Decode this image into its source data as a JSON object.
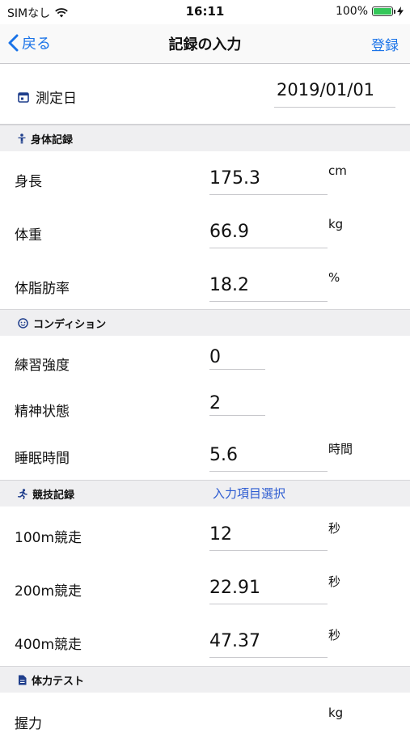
{
  "status_bar": {
    "carrier": "SIMなし",
    "time": "16:11",
    "battery": "100%"
  },
  "nav": {
    "back_label": "戻る",
    "title": "記録の入力",
    "action_label": "登録"
  },
  "measure_date": {
    "label": "測定日",
    "value": "2019/01/01"
  },
  "sections": {
    "body": {
      "title": "身体記録",
      "icon": "person-icon"
    },
    "condition": {
      "title": "コンディション",
      "icon": "face-icon"
    },
    "athletics": {
      "title": "競技記録",
      "icon": "runner-icon",
      "link": "入力項目選択"
    },
    "fitness": {
      "title": "体力テスト",
      "icon": "document-icon"
    }
  },
  "body_rows": [
    {
      "label": "身長",
      "value": "175.3",
      "unit": "cm"
    },
    {
      "label": "体重",
      "value": "66.9",
      "unit": "kg"
    },
    {
      "label": "体脂肪率",
      "value": "18.2",
      "unit": "%"
    }
  ],
  "condition_rows": [
    {
      "label": "練習強度",
      "value": "0",
      "unit": ""
    },
    {
      "label": "精神状態",
      "value": "2",
      "unit": ""
    },
    {
      "label": "睡眠時間",
      "value": "5.6",
      "unit": "時間"
    }
  ],
  "athletics_rows": [
    {
      "label": "100m競走",
      "value": "12",
      "unit": "秒"
    },
    {
      "label": "200m競走",
      "value": "22.91",
      "unit": "秒"
    },
    {
      "label": "400m競走",
      "value": "47.37",
      "unit": "秒"
    }
  ],
  "fitness_rows": [
    {
      "label": "握力",
      "value": "",
      "unit": "kg"
    }
  ],
  "colors": {
    "accent": "#1a73e8",
    "link": "#2c5bd1",
    "section_bg": "#efeff1",
    "battery": "#34c759"
  }
}
